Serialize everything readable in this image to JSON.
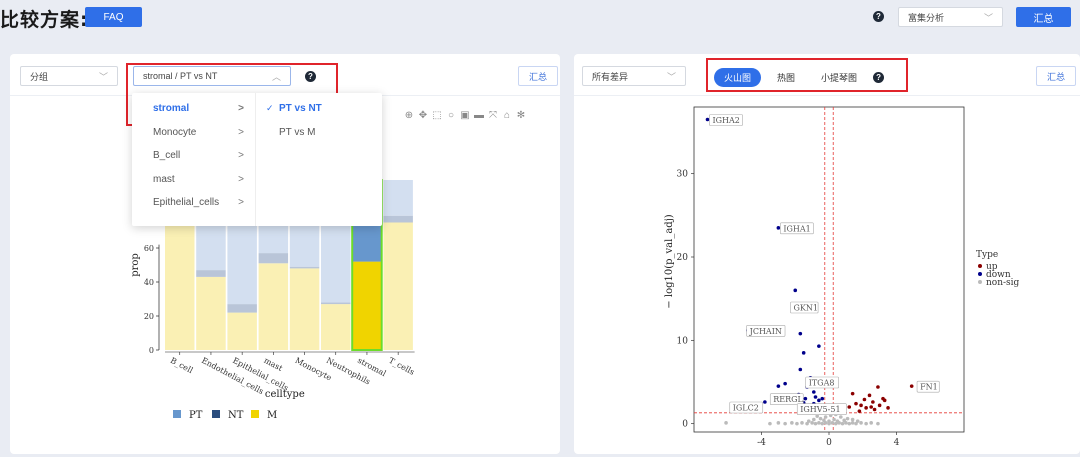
{
  "header": {
    "title": "比较方案:",
    "faq_label": "FAQ",
    "help_label": "?",
    "enrich_select": "富集分析",
    "summary_label": "汇总"
  },
  "left_panel": {
    "group_select": "分组",
    "compare_select": "stromal / PT vs NT",
    "summary_label": "汇总",
    "dropdown": {
      "cell_types": [
        {
          "label": "stromal",
          "active": true
        },
        {
          "label": "Monocyte",
          "active": false
        },
        {
          "label": "B_cell",
          "active": false
        },
        {
          "label": "mast",
          "active": false
        },
        {
          "label": "Epithelial_cells",
          "active": false
        }
      ],
      "comparisons": [
        {
          "label": "PT vs NT",
          "active": true
        },
        {
          "label": "PT vs M",
          "active": false
        }
      ]
    }
  },
  "right_panel": {
    "diff_select": "所有差异",
    "tabs": [
      "火山图",
      "热图",
      "小提琴图"
    ],
    "active_tab": "火山图",
    "summary_label": "汇总"
  },
  "chart_data": [
    {
      "type": "bar",
      "stacked": true,
      "ylabel": "prop",
      "xlabel": "celltype",
      "ylim": [
        0,
        100
      ],
      "yticks": [
        0,
        20,
        40,
        60
      ],
      "categories": [
        "B_cell",
        "Endothelial_cells",
        "Epithelial_cells",
        "mast",
        "Monocyte",
        "Neutrophils",
        "stromal",
        "T_cells"
      ],
      "series": [
        {
          "name": "M",
          "color": "#faf0b4",
          "values": [
            100,
            43,
            22,
            51,
            48,
            27,
            52,
            75
          ]
        },
        {
          "name": "NT",
          "color": "#b9c5d8",
          "values": [
            0,
            4,
            5,
            6,
            1,
            1,
            0,
            4
          ]
        },
        {
          "name": "PT",
          "color": "#d3dff0",
          "values": [
            0,
            53,
            73,
            43,
            51,
            72,
            48,
            21
          ]
        }
      ],
      "legend": [
        {
          "name": "PT",
          "color": "#6797cd"
        },
        {
          "name": "NT",
          "color": "#2a4d7e"
        },
        {
          "name": "M",
          "color": "#f0d400"
        }
      ],
      "highlight": "stromal"
    },
    {
      "type": "scatter",
      "xlabel": "",
      "ylabel": "− log10(p_val_adj)",
      "yticks": [
        0,
        10,
        20,
        30
      ],
      "xticks": [
        -4,
        0,
        4
      ],
      "xlim": [
        -8,
        8
      ],
      "ylim": [
        -1,
        38
      ],
      "legend_title": "Type",
      "legend": [
        {
          "name": "up",
          "color": "#8b0000"
        },
        {
          "name": "down",
          "color": "#00008b"
        },
        {
          "name": "non-sig",
          "color": "#bbbbbb"
        }
      ],
      "labels": [
        {
          "text": "IGHA2",
          "x": -7.2,
          "y": 36.5
        },
        {
          "text": "IGHA1",
          "x": -3.0,
          "y": 23.5
        },
        {
          "text": "GKN1",
          "x": -2.4,
          "y": 14.0
        },
        {
          "text": "JCHAIN",
          "x": -5.0,
          "y": 11.2
        },
        {
          "text": "ITGA8",
          "x": -1.5,
          "y": 5.0
        },
        {
          "text": "RERGL",
          "x": -3.6,
          "y": 3.0
        },
        {
          "text": "IGLC2",
          "x": -6.0,
          "y": 2.0
        },
        {
          "text": "IGHV5-51",
          "x": -2.0,
          "y": 1.8
        },
        {
          "text": "FN1",
          "x": 5.1,
          "y": 4.5
        }
      ],
      "up": [
        [
          0.8,
          1.4
        ],
        [
          1.2,
          2.0
        ],
        [
          1.6,
          2.4
        ],
        [
          1.8,
          1.5
        ],
        [
          2.1,
          2.9
        ],
        [
          2.2,
          1.9
        ],
        [
          2.4,
          3.4
        ],
        [
          2.6,
          2.6
        ],
        [
          2.7,
          1.7
        ],
        [
          2.9,
          4.4
        ],
        [
          3.0,
          2.2
        ],
        [
          3.2,
          3.0
        ],
        [
          3.3,
          2.8
        ],
        [
          1.4,
          3.6
        ],
        [
          1.9,
          2.2
        ],
        [
          2.5,
          2.0
        ],
        [
          3.5,
          1.9
        ],
        [
          4.9,
          4.5
        ]
      ],
      "down": [
        [
          -7.2,
          36.5
        ],
        [
          -3.0,
          23.5
        ],
        [
          -2.0,
          16.0
        ],
        [
          -1.2,
          14.0
        ],
        [
          -4.8,
          11.2
        ],
        [
          -1.7,
          10.8
        ],
        [
          -1.5,
          8.5
        ],
        [
          -0.6,
          9.3
        ],
        [
          -1.7,
          6.5
        ],
        [
          -2.6,
          4.8
        ],
        [
          -3.0,
          4.5
        ],
        [
          -1.1,
          5.5
        ],
        [
          -0.7,
          5.2
        ],
        [
          -1.3,
          4.4
        ],
        [
          -0.5,
          4.6
        ],
        [
          -0.9,
          3.8
        ],
        [
          -1.8,
          3.5
        ],
        [
          -1.4,
          3.0
        ],
        [
          -2.2,
          2.6
        ],
        [
          -0.6,
          2.8
        ],
        [
          -0.9,
          2.4
        ],
        [
          -1.2,
          2.1
        ],
        [
          -0.5,
          2.2
        ],
        [
          -0.8,
          3.2
        ],
        [
          -1.5,
          2.5
        ],
        [
          -0.4,
          3.0
        ],
        [
          -1.0,
          1.8
        ],
        [
          -3.8,
          2.6
        ],
        [
          -0.6,
          1.7
        ]
      ],
      "nonsig": [
        [
          -6.1,
          0.1
        ],
        [
          -3.5,
          0.0
        ],
        [
          -3.0,
          0.1
        ],
        [
          -2.6,
          0.0
        ],
        [
          -2.2,
          0.1
        ],
        [
          -1.9,
          0.0
        ],
        [
          -1.6,
          0.1
        ],
        [
          -1.3,
          0.0
        ],
        [
          -1.0,
          0.1
        ],
        [
          -0.8,
          0.0
        ],
        [
          -0.6,
          0.1
        ],
        [
          -0.4,
          0.0
        ],
        [
          -0.2,
          0.1
        ],
        [
          0.0,
          0.0
        ],
        [
          0.2,
          0.1
        ],
        [
          0.4,
          0.0
        ],
        [
          0.6,
          0.1
        ],
        [
          0.8,
          0.0
        ],
        [
          1.0,
          0.1
        ],
        [
          1.2,
          0.0
        ],
        [
          1.4,
          0.1
        ],
        [
          1.6,
          0.0
        ],
        [
          1.9,
          0.1
        ],
        [
          2.2,
          0.0
        ],
        [
          2.5,
          0.1
        ],
        [
          2.9,
          0.0
        ],
        [
          -0.3,
          0.4
        ],
        [
          0.3,
          0.5
        ],
        [
          -0.5,
          0.6
        ],
        [
          0.5,
          0.3
        ],
        [
          0.9,
          0.4
        ],
        [
          -0.9,
          0.5
        ],
        [
          0.7,
          0.8
        ],
        [
          1.1,
          0.6
        ],
        [
          -0.2,
          0.8
        ],
        [
          0.1,
          1.0
        ],
        [
          -0.7,
          0.9
        ],
        [
          1.4,
          0.5
        ],
        [
          0.0,
          0.3
        ],
        [
          -1.2,
          0.3
        ],
        [
          1.7,
          0.3
        ],
        [
          0.4,
          1.1
        ]
      ]
    }
  ]
}
